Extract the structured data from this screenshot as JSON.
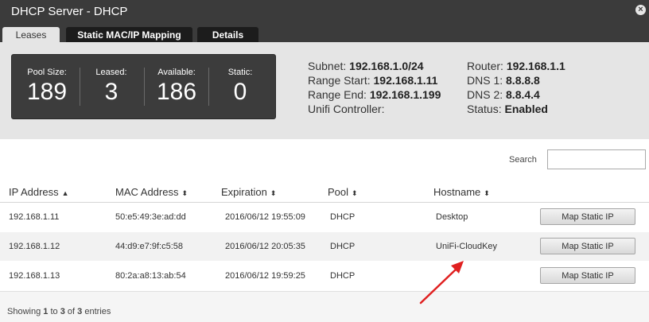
{
  "window": {
    "title": "DHCP Server - DHCP",
    "close_icon": "close-icon"
  },
  "tabs": [
    {
      "label": "Leases",
      "active": true
    },
    {
      "label": "Static MAC/IP Mapping",
      "active": false
    },
    {
      "label": "Details",
      "active": false
    }
  ],
  "stats": [
    {
      "label": "Pool Size:",
      "value": "189"
    },
    {
      "label": "Leased:",
      "value": "3"
    },
    {
      "label": "Available:",
      "value": "186"
    },
    {
      "label": "Static:",
      "value": "0"
    }
  ],
  "info_left": [
    {
      "label": "Subnet:",
      "value": "192.168.1.0/24"
    },
    {
      "label": "Range Start:",
      "value": "192.168.1.11"
    },
    {
      "label": "Range End:",
      "value": "192.168.1.199"
    },
    {
      "label": "Unifi Controller:",
      "value": ""
    }
  ],
  "info_right": [
    {
      "label": "Router:",
      "value": "192.168.1.1"
    },
    {
      "label": "DNS 1:",
      "value": "8.8.8.8"
    },
    {
      "label": "DNS 2:",
      "value": "8.8.4.4"
    },
    {
      "label": "Status:",
      "value": "Enabled"
    }
  ],
  "search": {
    "label": "Search",
    "value": ""
  },
  "table": {
    "columns": [
      "IP Address",
      "MAC Address",
      "Expiration",
      "Pool",
      "Hostname"
    ],
    "sort_icons": {
      "IP Address": "▲",
      "other": "⬍"
    },
    "rows": [
      {
        "ip": "192.168.1.11",
        "mac": "50:e5:49:3e:ad:dd",
        "expiration": "2016/06/12 19:55:09",
        "pool": "DHCP",
        "hostname": "Desktop",
        "action": "Map Static IP"
      },
      {
        "ip": "192.168.1.12",
        "mac": "44:d9:e7:9f:c5:58",
        "expiration": "2016/06/12 20:05:35",
        "pool": "DHCP",
        "hostname": "UniFi-CloudKey",
        "action": "Map Static IP"
      },
      {
        "ip": "192.168.1.13",
        "mac": "80:2a:a8:13:ab:54",
        "expiration": "2016/06/12 19:59:25",
        "pool": "DHCP",
        "hostname": "",
        "action": "Map Static IP"
      }
    ]
  },
  "footer": {
    "showing": "Showing",
    "from": "1",
    "to_word": "to",
    "to": "3",
    "of_word": "of",
    "total": "3",
    "entries": "entries"
  },
  "annotation": {
    "arrow_color": "#e02020"
  }
}
